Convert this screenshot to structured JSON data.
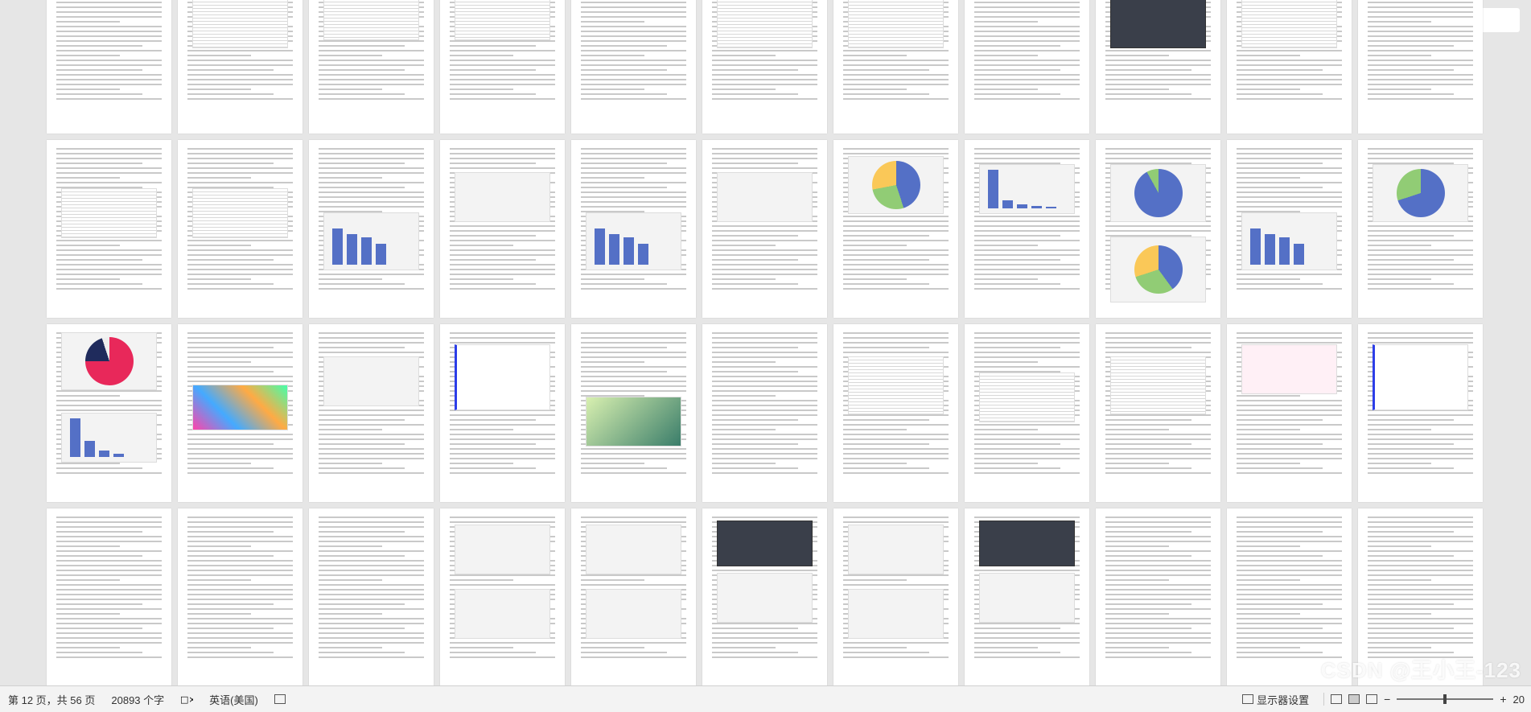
{
  "status_bar": {
    "page_info": "第 12 页，共 56 页",
    "word_count": "20893 个字",
    "language": "英语(美国)",
    "display_settings": "显示器设置",
    "zoom_value": "20"
  },
  "watermark": "CSDN @王小王-123",
  "colors": {
    "chart_blue": "#5470c6",
    "chart_yellow": "#fac858",
    "chart_green": "#91cc75",
    "pie_red": "#e8285a",
    "pie_navy": "#1f2b5c"
  },
  "icons": [
    "spell-check-icon",
    "focus-icon",
    "read-mode-icon",
    "print-layout-icon",
    "web-layout-icon",
    "zoom-out-icon",
    "zoom-in-icon"
  ]
}
